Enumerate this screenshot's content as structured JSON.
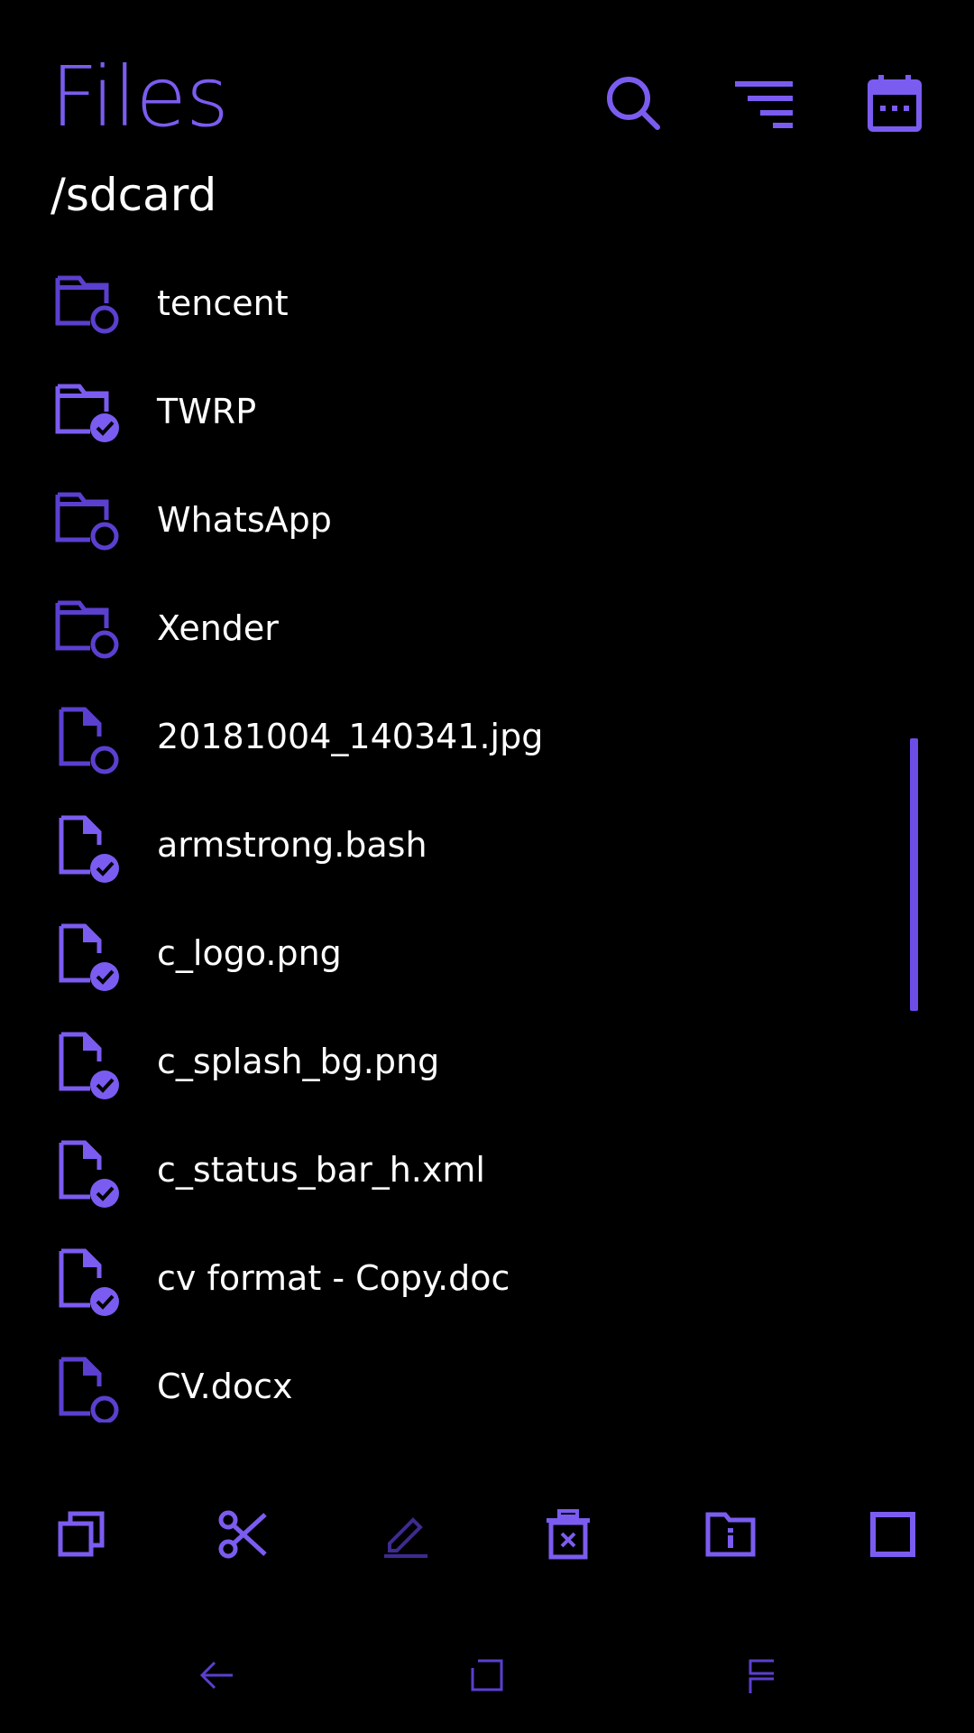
{
  "app": {
    "title": "Files",
    "path": "/sdcard"
  },
  "colors": {
    "accent": "#7b5cf0",
    "accent_dim": "#5b3fcf",
    "text": "#ffffff",
    "background": "#000000"
  },
  "header_icons": [
    {
      "name": "search-icon"
    },
    {
      "name": "sort-icon"
    },
    {
      "name": "calendar-icon"
    }
  ],
  "files": [
    {
      "name": "tencent",
      "type": "folder",
      "selected": false
    },
    {
      "name": "TWRP",
      "type": "folder",
      "selected": true
    },
    {
      "name": "WhatsApp",
      "type": "folder",
      "selected": false
    },
    {
      "name": "Xender",
      "type": "folder",
      "selected": false
    },
    {
      "name": "20181004_140341.jpg",
      "type": "file",
      "selected": false
    },
    {
      "name": "armstrong.bash",
      "type": "file",
      "selected": true
    },
    {
      "name": "c_logo.png",
      "type": "file",
      "selected": true
    },
    {
      "name": "c_splash_bg.png",
      "type": "file",
      "selected": true
    },
    {
      "name": "c_status_bar_h.xml",
      "type": "file",
      "selected": true
    },
    {
      "name": "cv format - Copy.doc",
      "type": "file",
      "selected": true
    },
    {
      "name": "CV.docx",
      "type": "file",
      "selected": false
    }
  ],
  "actions": [
    {
      "name": "copy-icon"
    },
    {
      "name": "cut-icon"
    },
    {
      "name": "rename-icon",
      "disabled": true
    },
    {
      "name": "delete-icon"
    },
    {
      "name": "folder-info-icon"
    },
    {
      "name": "select-all-icon"
    }
  ],
  "nav": [
    {
      "name": "back-icon"
    },
    {
      "name": "home-icon"
    },
    {
      "name": "recents-icon"
    }
  ]
}
